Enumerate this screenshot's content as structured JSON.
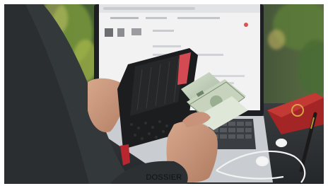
{
  "caption": "DOSSIER"
}
